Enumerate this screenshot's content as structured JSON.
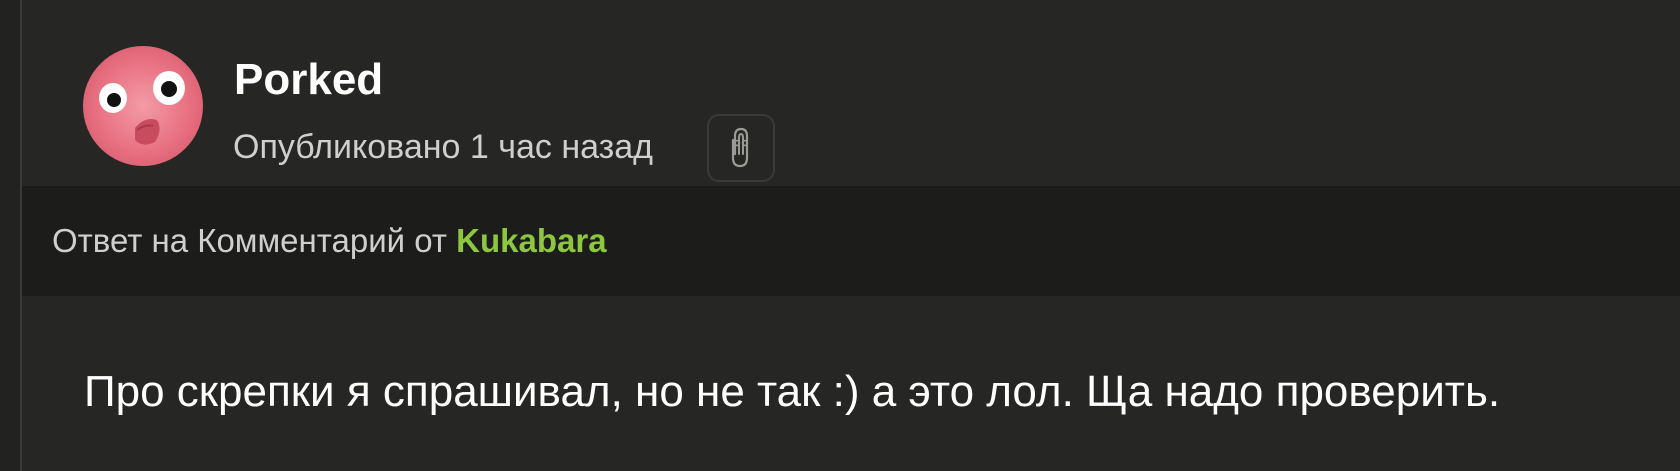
{
  "comment": {
    "author": "Porked",
    "published": "Опубликовано 1 час назад",
    "reply": {
      "prefix": "Ответ на Комментарий от",
      "author": "Kukabara"
    },
    "text": "Про скрепки я спрашивал, но не так :) а это лол. Ща надо проверить."
  },
  "icons": {
    "avatar": "pink-bird-avatar",
    "reaction": "paperclip-icon"
  },
  "colors": {
    "background": "#262624",
    "reply_bar": "#1c1c1a",
    "accent": "#8dc63f",
    "text": "#ffffff",
    "muted_text": "#cfcfcf"
  }
}
